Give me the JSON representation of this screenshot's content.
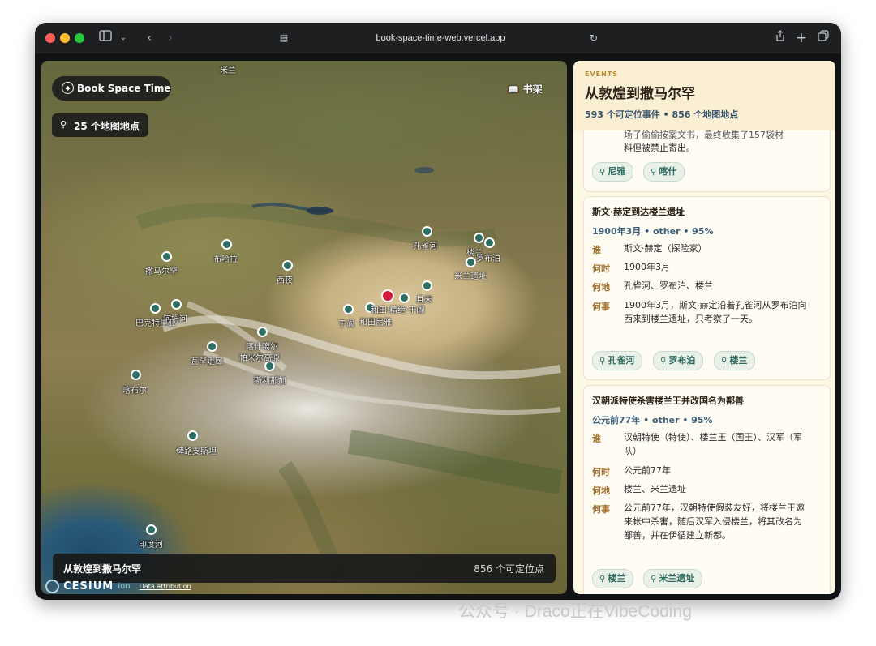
{
  "browser": {
    "url": "book-space-time-web.vercel.app"
  },
  "map": {
    "brand": "Book Space Time",
    "bookshelf_label": "书架",
    "location_count": "25 个地图地点",
    "caption_title": "从敦煌到撒马尔罕",
    "caption_count": "856 个可定位点",
    "attribution_logo": "CESIUM",
    "attribution_suffix": "ion",
    "attribution_link": "Data attribution",
    "labels": [
      {
        "id": "milan",
        "text": "米兰"
      },
      {
        "id": "kongque",
        "text": "孔雀河"
      },
      {
        "id": "loulan",
        "text": "楼兰"
      },
      {
        "id": "luobu",
        "text": "罗布泊"
      },
      {
        "id": "milan-site",
        "text": "米兰遗址"
      },
      {
        "id": "samarkand",
        "text": "撒马尔罕"
      },
      {
        "id": "bukhara",
        "text": "布哈拉"
      },
      {
        "id": "xiye",
        "text": "西夜"
      },
      {
        "id": "qiemo",
        "text": "且末"
      },
      {
        "id": "niya-region",
        "text": "和田·精绝·于阗"
      },
      {
        "id": "yutian",
        "text": "于阗"
      },
      {
        "id": "hetian",
        "text": "和田尼雅"
      },
      {
        "id": "pianzhi",
        "text": "阿姆河"
      },
      {
        "id": "balkh",
        "text": "巴克特里亚"
      },
      {
        "id": "kashgar",
        "text": "喀什噶尔"
      },
      {
        "id": "wakhan",
        "text": "瓦罕走廊"
      },
      {
        "id": "pamir",
        "text": "帕米尔高原"
      },
      {
        "id": "srinagar",
        "text": "斯利那加"
      },
      {
        "id": "kabul",
        "text": "喀布尔"
      },
      {
        "id": "baluchistan",
        "text": "俾路支斯坦"
      },
      {
        "id": "indus",
        "text": "印度河"
      }
    ]
  },
  "panel": {
    "tag": "EVENTS",
    "title": "从敦煌到撒马尔罕",
    "subtitle": "593 个可定位事件 • 856 个地图地点",
    "cards": [
      {
        "partial_text_1": "场子偷偷按案文书，最终收集了157袋材",
        "partial_text_2": "料但被禁止寄出。",
        "chips": [
          "尼雅",
          "喀什"
        ]
      },
      {
        "title": "斯文·赫定到达楼兰遗址",
        "meta": "1900年3月 • other • 95%",
        "who_k": "谁",
        "who": "斯文·赫定（探险家）",
        "when_k": "何时",
        "when": "1900年3月",
        "where_k": "何地",
        "where": "孔雀河、罗布泊、楼兰",
        "what_k": "何事",
        "what": "1900年3月，斯文·赫定沿着孔雀河从罗布泊向西来到楼兰遗址，只考察了一天。",
        "chips": [
          "孔雀河",
          "罗布泊",
          "楼兰"
        ]
      },
      {
        "title": "汉朝派特使杀害楼兰王并改国名为鄯善",
        "meta": "公元前77年 • other • 95%",
        "who_k": "谁",
        "who": "汉朝特使（特使）、楼兰王（国王）、汉军（军队）",
        "when_k": "何时",
        "when": "公元前77年",
        "where_k": "何地",
        "where": "楼兰、米兰遗址",
        "what_k": "何事",
        "what": "公元前77年，汉朝特使假装友好，将楼兰王邀来帐中杀害，随后汉军入侵楼兰，将其改名为鄯善，并在伊循建立新都。",
        "chips": [
          "楼兰",
          "米兰遗址"
        ]
      }
    ]
  },
  "watermark": "公众号 · Draco正在VibeCoding",
  "colors": {
    "marker": "#2d6f63",
    "marker_active": "#d11b3a",
    "panel_bg": "#fdf7e6",
    "chip_text": "#2c6c61",
    "meta_text": "#3d5f7c",
    "key_text": "#a3712b"
  }
}
